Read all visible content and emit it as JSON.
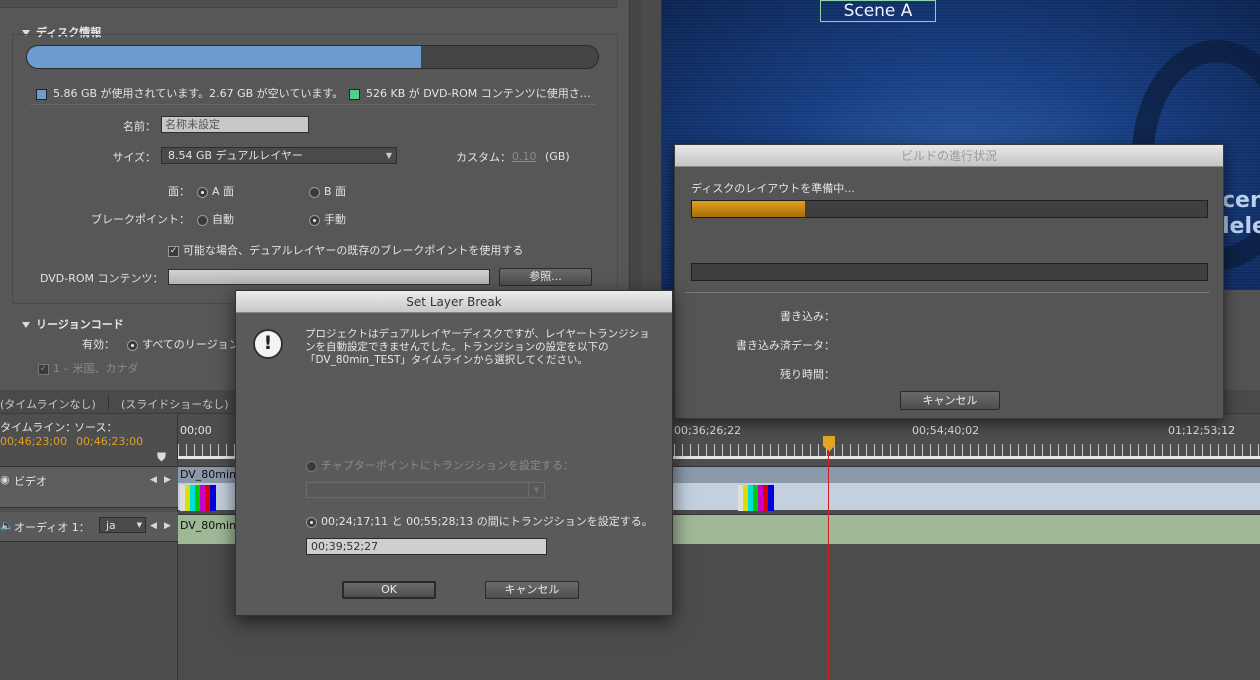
{
  "properties": {
    "disc_info_title": "ディスク情報",
    "usage_fraction": 0.69,
    "legend_used": "5.86 GB が使用されています。2.67 GB が空いています。",
    "legend_rom": "526 KB が DVD-ROM コンテンツに使用さ…",
    "name_label": "名前：",
    "name_value": "名称未設定",
    "size_label": "サイズ：",
    "size_value": "8.54 GB デュアルレイヤー",
    "custom_label": "カスタム：",
    "custom_value": "0.10",
    "custom_unit": "(GB)",
    "side_label": "面：",
    "side_a": "A 面",
    "side_b": "B 面",
    "break_label": "ブレークポイント：",
    "break_auto": "自動",
    "break_manual": "手動",
    "use_existing_label": "可能な場合、デュアルレイヤーの既存のブレークポイントを使用する",
    "rom_label": "DVD-ROM コンテンツ：",
    "browse_label": "参照...",
    "region_title": "リージョンコード",
    "enabled_label": "有効：",
    "all_regions": "すべてのリージョン",
    "region1": "1 – 米国、カナダ"
  },
  "monitor": {
    "scene_label": "Scene A",
    "edge_text_1": "cen",
    "edge_text_2": "lele"
  },
  "build": {
    "title": "ビルドの進行状況",
    "status": "ディスクのレイアウトを準備中...",
    "progress": 0.22,
    "write_label": "書き込み：",
    "written_label": "書き込み済データ：",
    "remaining_label": "残り時間：",
    "cancel_label": "キャンセル"
  },
  "timeline": {
    "tab_timeline": "(タイムラインなし)",
    "tab_slideshow": "(スライドショーなし)",
    "timeline_label": "タイムライン：",
    "source_label": "ソース：",
    "time_a": "00;46;23;00",
    "time_b": "00;46;23;00",
    "ruler": [
      "00;00",
      "00;36;26;22",
      "00;54;40;02",
      "01;12;53;12"
    ],
    "video_track": "ビデオ",
    "audio_track": "オーディオ 1：",
    "audio_lang": "ja",
    "clip_name": "DV_80min"
  },
  "dialog": {
    "title": "Set Layer Break",
    "message": "プロジェクトはデュアルレイヤーディスクですが、レイヤートランジションを自動設定できませんでした。トランジションの設定を以下の「DV_80min_TEST」タイムラインから選択してください。",
    "option_chapter": "チャプターポイントにトランジションを設定する：",
    "option_range": "00;24;17;11 と 00;55;28;13 の間にトランジションを設定する。",
    "timecode_value": "00;39;52;27",
    "ok_label": "OK",
    "cancel_label": "キャンセル"
  },
  "colors": {
    "usage_blue": "#6f9ccf",
    "rom_green": "#4fd08a",
    "progress_gold": "#c88a10",
    "playhead_red": "#d22020"
  }
}
